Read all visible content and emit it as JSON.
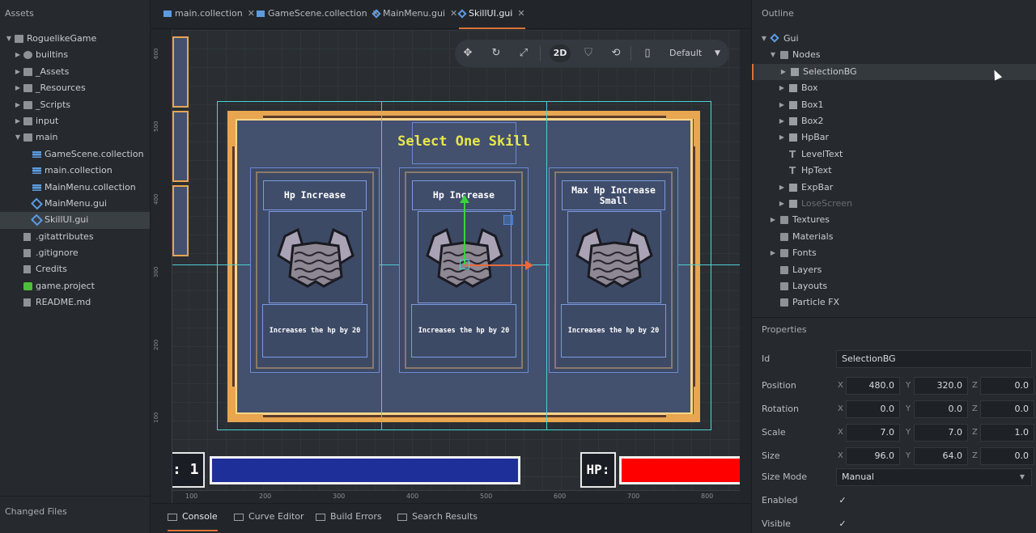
{
  "assets": {
    "title": "Assets",
    "items": [
      {
        "label": "RoguelikeGame",
        "icon": "folder-icon",
        "arrow": "▼",
        "indent": 0
      },
      {
        "label": "builtins",
        "icon": "gear-icon",
        "arrow": "▶",
        "indent": 1
      },
      {
        "label": "_Assets",
        "icon": "folder-icon",
        "arrow": "▶",
        "indent": 1
      },
      {
        "label": "_Resources",
        "icon": "folder-icon",
        "arrow": "▶",
        "indent": 1
      },
      {
        "label": "_Scripts",
        "icon": "folder-icon",
        "arrow": "▶",
        "indent": 1
      },
      {
        "label": "input",
        "icon": "folder-icon",
        "arrow": "▶",
        "indent": 1
      },
      {
        "label": "main",
        "icon": "folder-icon",
        "arrow": "▼",
        "indent": 1
      },
      {
        "label": "GameScene.collection",
        "icon": "collection-icon",
        "arrow": "",
        "indent": 2
      },
      {
        "label": "main.collection",
        "icon": "collection-icon",
        "arrow": "",
        "indent": 2
      },
      {
        "label": "MainMenu.collection",
        "icon": "collection-icon",
        "arrow": "",
        "indent": 2
      },
      {
        "label": "MainMenu.gui",
        "icon": "gui-icon",
        "arrow": "",
        "indent": 2
      },
      {
        "label": "SkillUI.gui",
        "icon": "gui-icon",
        "arrow": "",
        "indent": 2,
        "selected": true
      },
      {
        "label": ".gitattributes",
        "icon": "file-icon",
        "arrow": "",
        "indent": 1
      },
      {
        "label": ".gitignore",
        "icon": "file-icon",
        "arrow": "",
        "indent": 1
      },
      {
        "label": "Credits",
        "icon": "file-icon",
        "arrow": "",
        "indent": 1
      },
      {
        "label": "game.project",
        "icon": "project-icon",
        "arrow": "",
        "indent": 1
      },
      {
        "label": "README.md",
        "icon": "file-icon",
        "arrow": "",
        "indent": 1
      }
    ],
    "changed_files": "Changed Files"
  },
  "tabs": [
    {
      "label": "main.collection",
      "icon": "collection-icon",
      "close": "✕"
    },
    {
      "label": "GameScene.collection",
      "icon": "collection-icon",
      "close": "✕"
    },
    {
      "label": "MainMenu.gui",
      "icon": "gui-icon",
      "close": "✕"
    },
    {
      "label": "SkillUI.gui",
      "icon": "gui-icon",
      "close": "✕",
      "active": true
    }
  ],
  "toolbar": {
    "mode_2d": "2D",
    "layout": "Default",
    "caret": "▼"
  },
  "ruler": {
    "left": [
      "600",
      "500",
      "400",
      "300",
      "200",
      "100"
    ],
    "bottom": [
      "100",
      "200",
      "300",
      "400",
      "500",
      "600",
      "700",
      "800"
    ]
  },
  "scene": {
    "title": "Select One Skill",
    "cards": [
      {
        "title": "Hp Increase",
        "desc": "Increases the hp by 20"
      },
      {
        "title": "Hp Increase",
        "desc": "Increases the hp by 20"
      },
      {
        "title": "Max Hp Increase Small",
        "desc": "Increases the hp by 20"
      }
    ],
    "hud_level": ": 1",
    "hud_hp": "HP:",
    "colors": {
      "frame": "#e8a651",
      "board": "#43506e",
      "exp": "#1e2f9a",
      "hp": "#ff0000",
      "title": "#e8e84a"
    }
  },
  "bottom_tabs": [
    {
      "label": "Console",
      "active": true
    },
    {
      "label": "Curve Editor"
    },
    {
      "label": "Build Errors"
    },
    {
      "label": "Search Results"
    }
  ],
  "outline": {
    "title": "Outline",
    "items": [
      {
        "label": "Gui",
        "arrow": "▼",
        "icon": "gui-icon",
        "indent": 0
      },
      {
        "label": "Nodes",
        "arrow": "▼",
        "icon": "folder-icon",
        "indent": 1
      },
      {
        "label": "SelectionBG",
        "arrow": "▶",
        "icon": "box-icon",
        "indent": 2,
        "selected": true
      },
      {
        "label": "Box",
        "arrow": "▶",
        "icon": "box-icon",
        "indent": 2
      },
      {
        "label": "Box1",
        "arrow": "▶",
        "icon": "box-icon",
        "indent": 2
      },
      {
        "label": "Box2",
        "arrow": "▶",
        "icon": "box-icon",
        "indent": 2
      },
      {
        "label": "HpBar",
        "arrow": "▶",
        "icon": "box-icon",
        "indent": 2
      },
      {
        "label": "LevelText",
        "arrow": "",
        "icon": "text-icon",
        "indent": 2
      },
      {
        "label": "HpText",
        "arrow": "",
        "icon": "text-icon",
        "indent": 2
      },
      {
        "label": "ExpBar",
        "arrow": "▶",
        "icon": "box-icon",
        "indent": 2
      },
      {
        "label": "LoseScreen",
        "arrow": "▶",
        "icon": "box-icon",
        "indent": 2,
        "dim": true
      },
      {
        "label": "Textures",
        "arrow": "▶",
        "icon": "folder-icon",
        "indent": 1
      },
      {
        "label": "Materials",
        "arrow": "",
        "icon": "folder-icon",
        "indent": 1
      },
      {
        "label": "Fonts",
        "arrow": "▶",
        "icon": "folder-icon",
        "indent": 1
      },
      {
        "label": "Layers",
        "arrow": "",
        "icon": "folder-icon",
        "indent": 1
      },
      {
        "label": "Layouts",
        "arrow": "",
        "icon": "folder-icon",
        "indent": 1
      },
      {
        "label": "Particle FX",
        "arrow": "",
        "icon": "folder-icon",
        "indent": 1
      }
    ]
  },
  "properties": {
    "title": "Properties",
    "id_label": "Id",
    "id_value": "SelectionBG",
    "rows": [
      {
        "label": "Position",
        "x": "480.0",
        "y": "320.0",
        "z": "0.0"
      },
      {
        "label": "Rotation",
        "x": "0.0",
        "y": "0.0",
        "z": "0.0"
      },
      {
        "label": "Scale",
        "x": "7.0",
        "y": "7.0",
        "z": "1.0"
      },
      {
        "label": "Size",
        "x": "96.0",
        "y": "64.0",
        "z": "0.0"
      }
    ],
    "axis_x": "X",
    "axis_y": "Y",
    "axis_z": "Z",
    "size_mode_label": "Size Mode",
    "size_mode_value": "Manual",
    "enabled_label": "Enabled",
    "visible_label": "Visible",
    "check": "✓"
  }
}
